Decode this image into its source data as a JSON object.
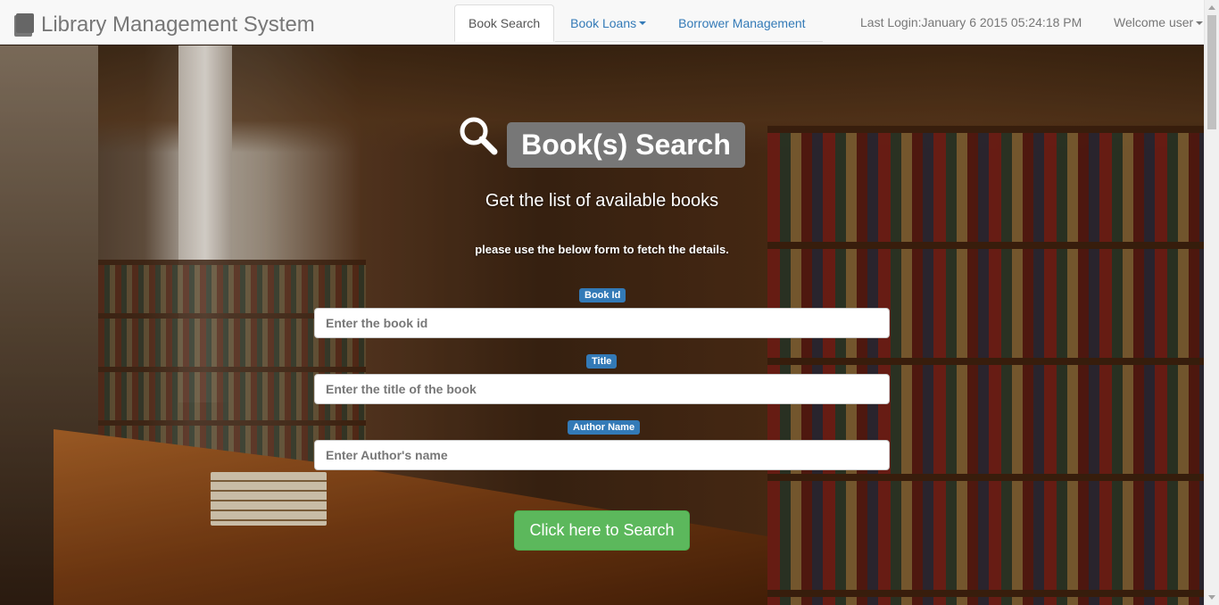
{
  "navbar": {
    "brand": "Library Management System",
    "brand_icon": "book-icon",
    "tabs": [
      {
        "label": "Book Search",
        "active": true
      },
      {
        "label": "Book Loans",
        "has_dropdown": true
      },
      {
        "label": "Borrower Management"
      }
    ],
    "last_login": "Last Login:January 6 2015 05:24:18 PM",
    "welcome": "Welcome user"
  },
  "hero": {
    "icon": "search-icon",
    "title": "Book(s) Search",
    "subtitle": "Get the list of available books",
    "hint": "please use the below form to fetch the details."
  },
  "form": {
    "book_id": {
      "label": "Book Id",
      "placeholder": "Enter the book id",
      "value": ""
    },
    "title": {
      "label": "Title",
      "placeholder": "Enter the title of the book",
      "value": ""
    },
    "author": {
      "label": "Author Name",
      "placeholder": "Enter Author's name",
      "value": ""
    },
    "submit_label": "Click here to Search"
  },
  "colors": {
    "accent": "#337ab7",
    "success": "#5cb85c",
    "badge": "#777777"
  }
}
